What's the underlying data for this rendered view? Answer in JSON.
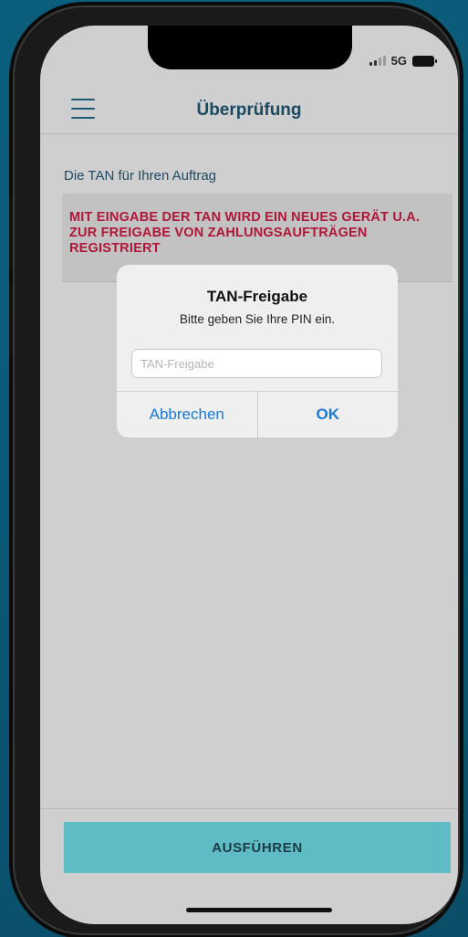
{
  "status_bar": {
    "network": "5G",
    "icons": [
      "signal-icon",
      "battery-icon"
    ]
  },
  "navbar": {
    "title": "Überprüfung",
    "menu_icon": "hamburger-menu-icon"
  },
  "content": {
    "label": "Die TAN für Ihren Auftrag",
    "warning": "MIT EINGABE DER TAN WIRD EIN NEUES GERÄT U.A. ZUR FREIGABE VON ZAHLUNGSAUFTRÄGEN REGISTRIERT"
  },
  "dialog": {
    "title": "TAN-Freigabe",
    "message": "Bitte geben Sie Ihre PIN ein.",
    "input": {
      "value": "",
      "placeholder": "TAN-Freigabe"
    },
    "cancel_label": "Abbrechen",
    "ok_label": "OK"
  },
  "footer": {
    "action_label": "AUSFÜHREN"
  },
  "colors": {
    "background": "#0a5e7c",
    "accent": "#1a7ad9",
    "warning": "#b0163a",
    "action_button": "#5fbcc4",
    "title": "#1b4a60"
  }
}
